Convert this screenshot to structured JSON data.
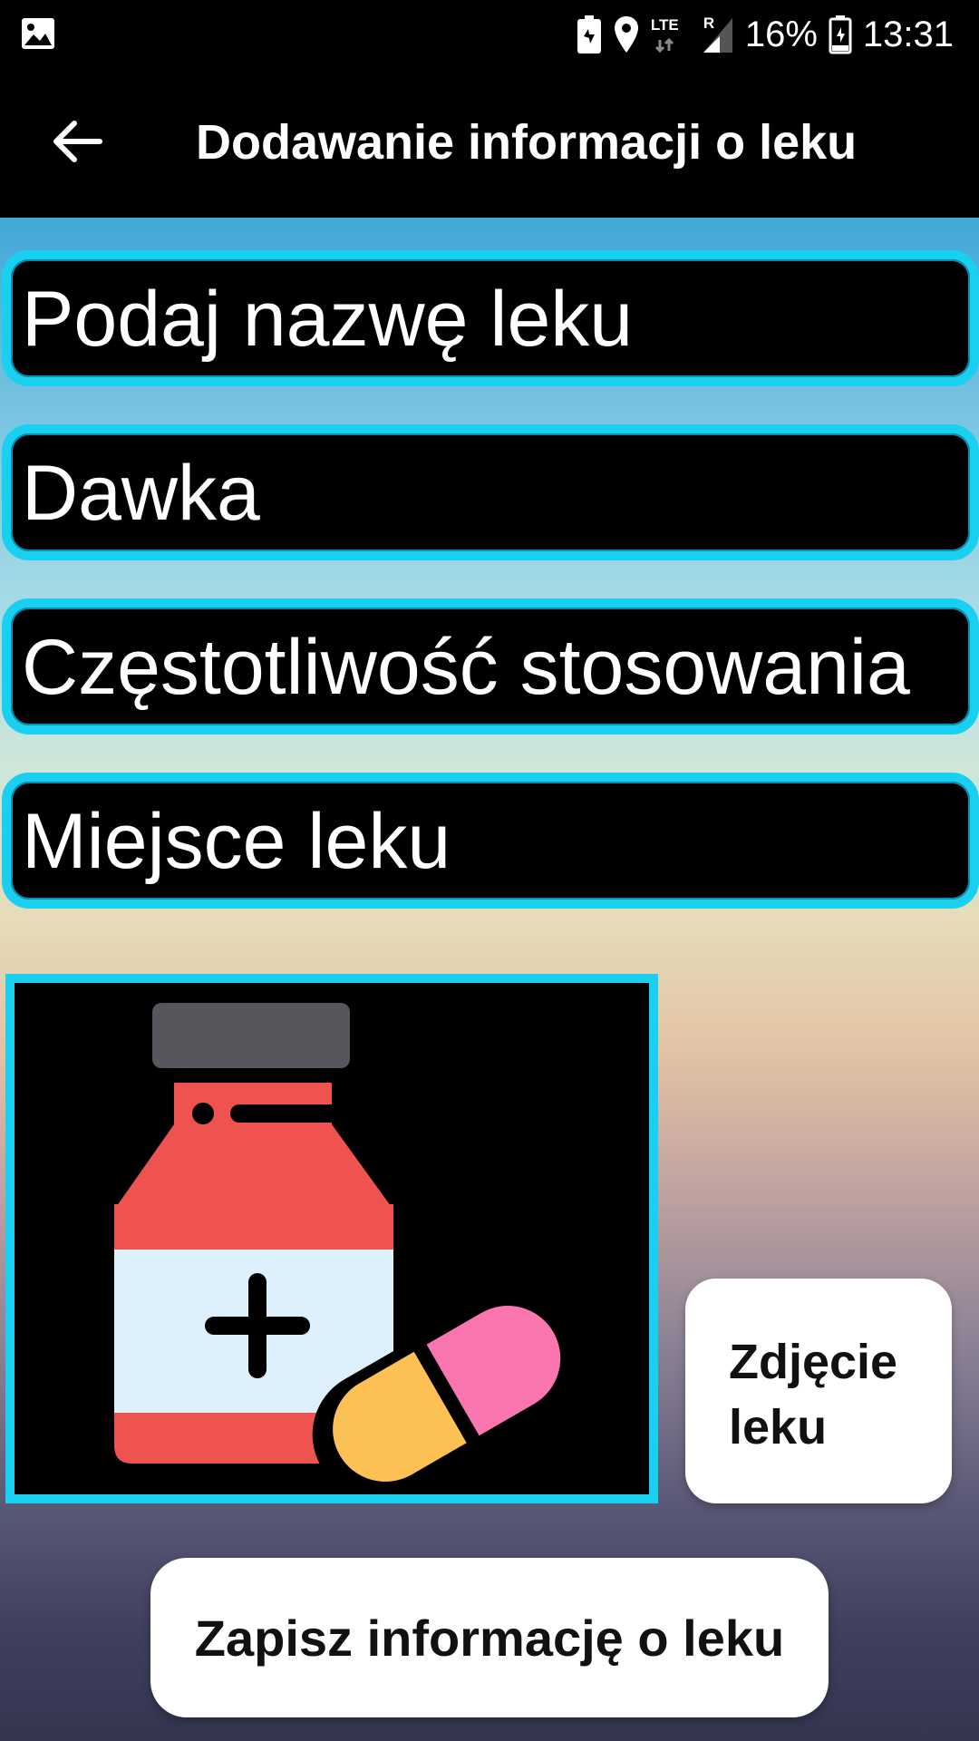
{
  "status_bar": {
    "battery_percent": "16%",
    "time": "13:31",
    "network_label": "LTE",
    "roaming_label": "R",
    "icons": [
      "gallery-icon",
      "battery-saver-icon",
      "location-icon",
      "lte-icon",
      "signal-icon",
      "battery-icon"
    ]
  },
  "toolbar": {
    "title": "Dodawanie informacji o leku",
    "back_icon": "arrow-left-icon"
  },
  "form": {
    "name_placeholder": "Podaj nazwę leku",
    "dose_placeholder": "Dawka",
    "frequency_placeholder": "Częstotliwość stosowania",
    "place_placeholder": "Miejsce leku"
  },
  "image": {
    "icon": "medicine-bottle-and-pill-icon"
  },
  "buttons": {
    "photo_label": "Zdjęcie leku",
    "save_label": "Zapisz informację o leku"
  },
  "colors": {
    "accent": "#1ad0f0",
    "toolbar": "#000000",
    "button_background": "#ffffff"
  }
}
